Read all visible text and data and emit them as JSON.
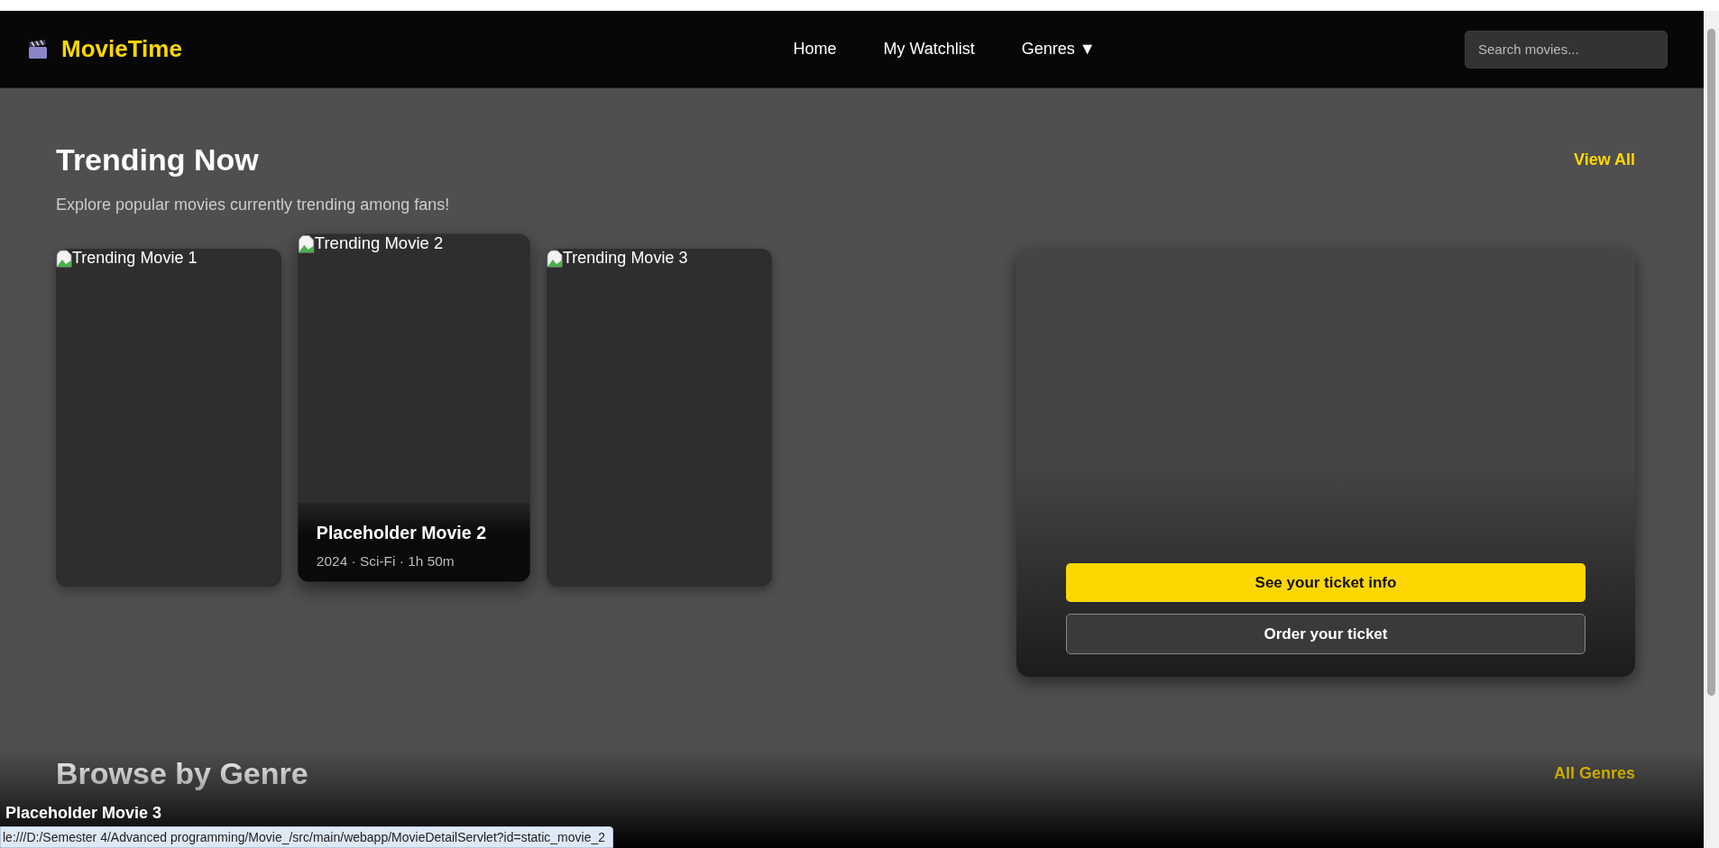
{
  "brand": {
    "name": "MovieTime"
  },
  "nav": [
    {
      "label": "Home"
    },
    {
      "label": "My Watchlist"
    },
    {
      "label": "Genres",
      "caret": "▼"
    }
  ],
  "search": {
    "placeholder": "Search movies..."
  },
  "trending": {
    "title": "Trending Now",
    "link": "View All",
    "subtitle": "Explore popular movies currently trending among fans!",
    "cards": [
      {
        "alt": "Trending Movie 1",
        "hovered": false
      },
      {
        "alt": "Trending Movie 2",
        "hovered": true,
        "title": "Placeholder Movie 2",
        "meta": "2024 · Sci-Fi · 1h 50m"
      },
      {
        "alt": "Trending Movie 3",
        "hovered": false
      }
    ]
  },
  "ticket_panel": {
    "buttons": [
      {
        "label": "See your ticket info",
        "kind": "primary"
      },
      {
        "label": "Order your ticket",
        "kind": "secondary"
      }
    ]
  },
  "genres": {
    "title": "Browse by Genre",
    "link": "All Genres"
  },
  "hover_preview": {
    "title": "Placeholder Movie 3"
  },
  "status_bar": {
    "url": "le:///D:/Semester 4/Advanced programming/Movie_/src/main/webapp/MovieDetailServlet?id=static_movie_2"
  }
}
